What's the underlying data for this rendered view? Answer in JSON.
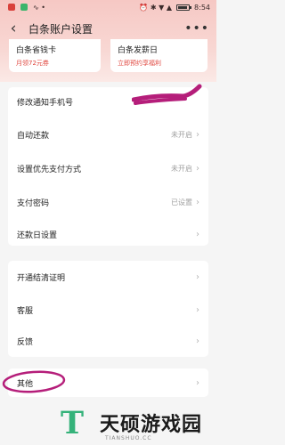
{
  "status_bar": {
    "left_glyphs": "∿ •",
    "right_glyphs": "⏰ ✱ ▼ ▲",
    "time": "8:54"
  },
  "nav": {
    "back_icon": "‹",
    "title": "白条账户设置",
    "more_icon": "•••"
  },
  "promos": [
    {
      "title": "白条省钱卡",
      "subtitle": "月领72元券"
    },
    {
      "title": "白条发薪日",
      "subtitle": "立即预约享福利"
    }
  ],
  "settings_group1": [
    {
      "label": "修改通知手机号",
      "value": ""
    },
    {
      "label": "自动还款",
      "value": "未开启"
    },
    {
      "label": "设置优先支付方式",
      "value": "未开启"
    },
    {
      "label": "支付密码",
      "value": "已设置"
    },
    {
      "label": "还款日设置",
      "value": ""
    }
  ],
  "settings_group2": [
    {
      "label": "开通结清证明"
    },
    {
      "label": "客服"
    },
    {
      "label": "反馈"
    }
  ],
  "settings_group3": [
    {
      "label": "其他"
    }
  ],
  "chevron": "›",
  "watermark": {
    "name": "天硕游戏园",
    "url": "TIANSHUO.CC"
  },
  "colors": {
    "accent_red": "#e0453d",
    "annotation_magenta": "#b51e7a",
    "logo_green": "#35b27a"
  }
}
